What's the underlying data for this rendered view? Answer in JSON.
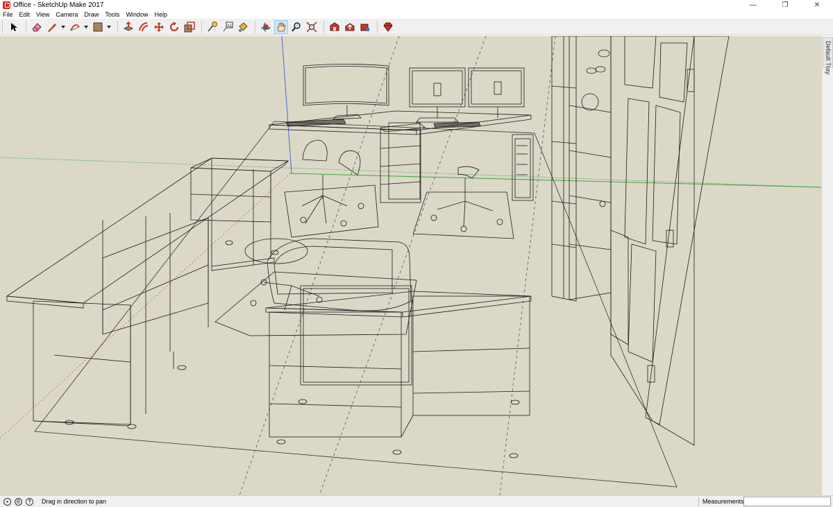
{
  "window": {
    "title": "Office - SketchUp Make 2017",
    "controls": [
      "—",
      "❐",
      "✕"
    ]
  },
  "menu": [
    "File",
    "Edit",
    "View",
    "Camera",
    "Draw",
    "Tools",
    "Window",
    "Help"
  ],
  "toolbar": {
    "tools": [
      {
        "name": "select-tool",
        "icon": "arrow-cursor-icon"
      },
      {
        "name": "eraser-tool",
        "icon": "eraser-icon"
      },
      {
        "name": "line-tool",
        "icon": "pencil-icon",
        "dropdown": true
      },
      {
        "name": "arc-tool",
        "icon": "arc-icon",
        "dropdown": true
      },
      {
        "name": "shape-tool",
        "icon": "rectangle-icon",
        "dropdown": true
      },
      {
        "name": "push-pull-tool",
        "icon": "push-pull-icon"
      },
      {
        "name": "offset-tool",
        "icon": "offset-icon"
      },
      {
        "name": "move-tool",
        "icon": "move-icon"
      },
      {
        "name": "rotate-tool",
        "icon": "rotate-icon"
      },
      {
        "name": "scale-tool",
        "icon": "scale-icon"
      },
      {
        "name": "tape-measure-tool",
        "icon": "tape-measure-icon"
      },
      {
        "name": "text-tool",
        "icon": "text-icon"
      },
      {
        "name": "paint-bucket-tool",
        "icon": "paint-bucket-icon"
      },
      {
        "name": "orbit-tool",
        "icon": "orbit-icon"
      },
      {
        "name": "pan-tool",
        "icon": "hand-icon",
        "active": true
      },
      {
        "name": "zoom-tool",
        "icon": "magnifier-icon"
      },
      {
        "name": "zoom-extents-tool",
        "icon": "zoom-extents-icon"
      },
      {
        "name": "3d-warehouse-tool",
        "icon": "warehouse-icon"
      },
      {
        "name": "share-model-tool",
        "icon": "share-model-icon"
      },
      {
        "name": "extension-warehouse-tool",
        "icon": "extension-icon"
      },
      {
        "name": "sketchup-extension-tool",
        "icon": "gem-icon"
      }
    ]
  },
  "tray": {
    "label": "Default Tray"
  },
  "status": {
    "message": "Drag in direction to pan",
    "measurements_label": "Measurements",
    "measurements_value": ""
  },
  "colors": {
    "viewport_bg": "#dbd8c8",
    "axis_red": "#d14a4a",
    "axis_green": "#3fa33f",
    "axis_blue": "#4f66c9",
    "active_tool": "#cce4f7"
  }
}
